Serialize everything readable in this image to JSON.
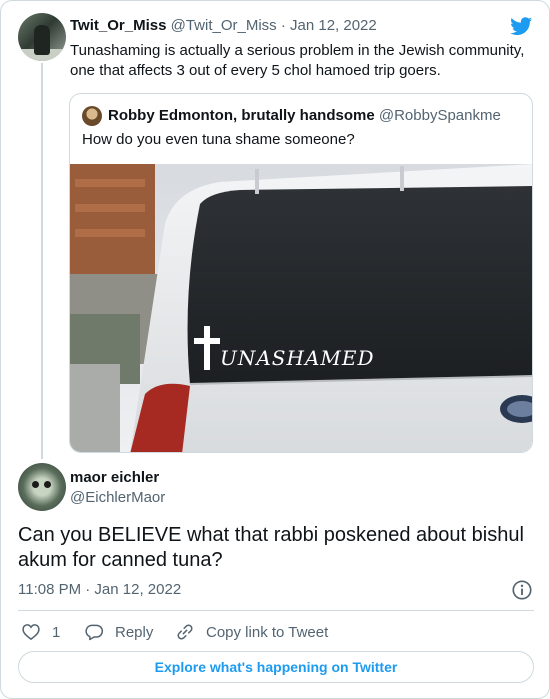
{
  "parent_tweet": {
    "display_name": "Twit_Or_Miss",
    "handle_date": "@Twit_Or_Miss · Jan 12, 2022",
    "text": "Tunashaming is actually a serious problem in the Jewish community, one that affects 3 out of every 5 chol hamoed trip goers."
  },
  "quoted_tweet": {
    "display_name": "Robby Edmonton, brutally handsome",
    "handle": "@RobbySpankme",
    "text": "How do you even tuna shame someone?",
    "image_decal_text": "UNASHAMED"
  },
  "reply_tweet": {
    "display_name": "maor eichler",
    "handle": "@EichlerMaor",
    "text": "Can you BELIEVE what that rabbi poskened about bishul akum for canned tuna?",
    "timestamp": "11:08 PM · Jan 12, 2022"
  },
  "actions": {
    "like_count": "1",
    "reply_label": "Reply",
    "copy_label": "Copy link to Tweet"
  },
  "footer": {
    "explore_label": "Explore what's happening on Twitter"
  },
  "colors": {
    "accent": "#1d9bf0",
    "border": "#cfd9de",
    "secondary_text": "#536471"
  },
  "icons": [
    "twitter-bird-icon",
    "info-icon",
    "heart-icon",
    "reply-bubble-icon",
    "link-icon"
  ]
}
